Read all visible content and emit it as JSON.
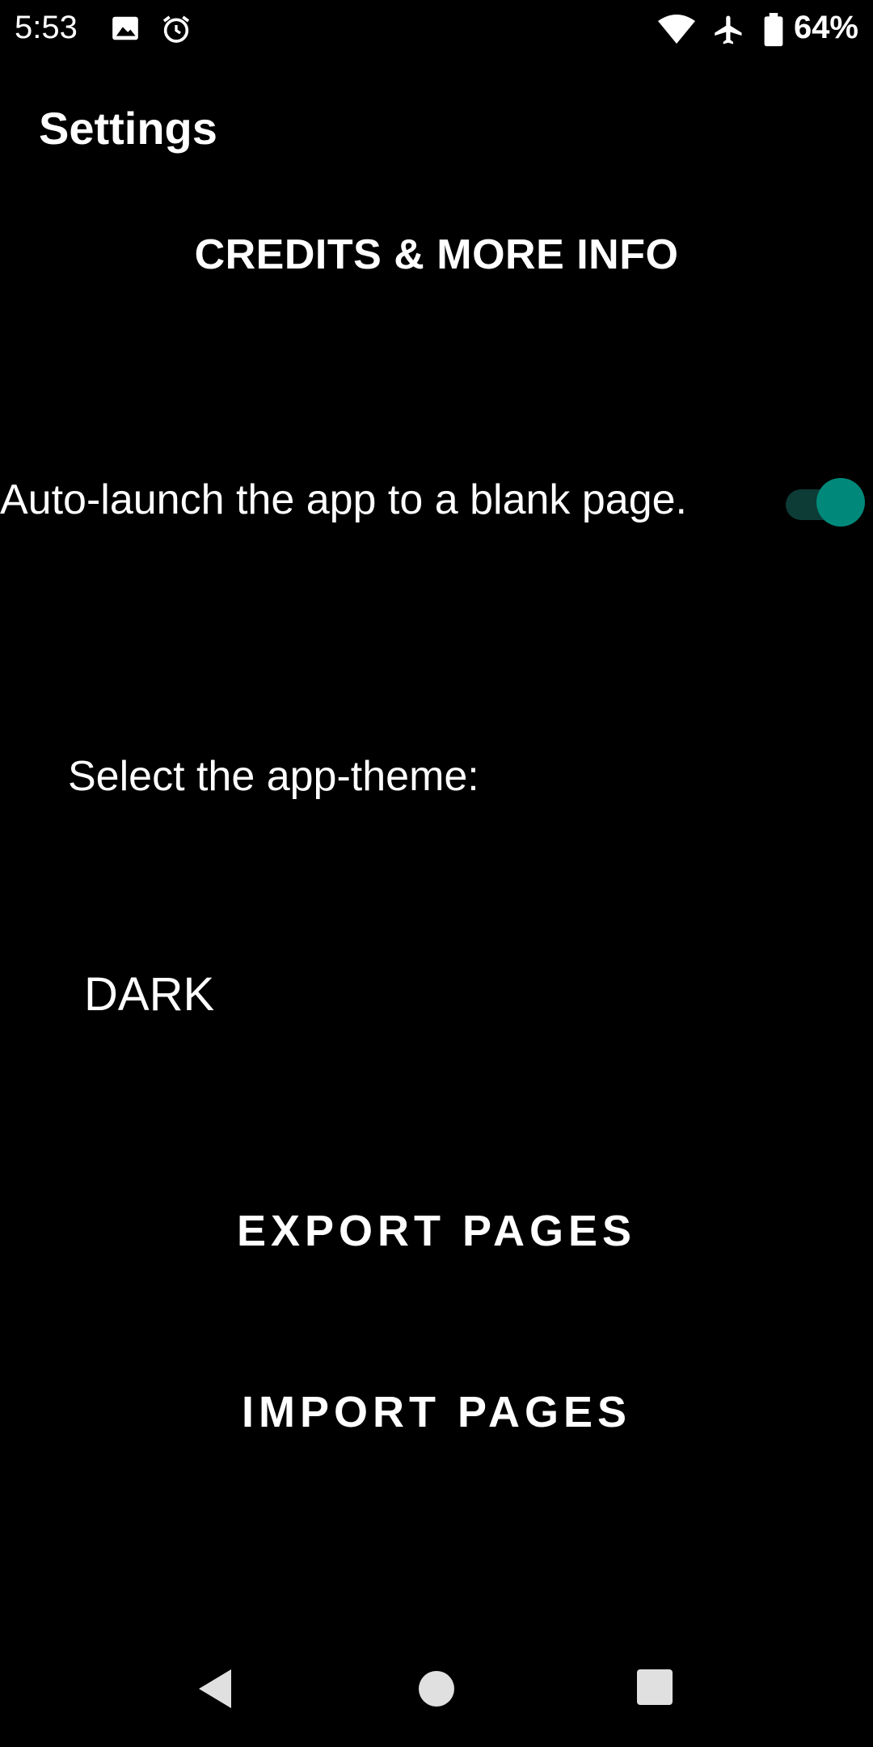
{
  "status_bar": {
    "time": "5:53",
    "battery": "64%",
    "icons": [
      "image-icon",
      "alarm-icon",
      "wifi-icon",
      "airplane-icon",
      "battery-icon"
    ]
  },
  "header": {
    "title": "Settings"
  },
  "credits": {
    "label": "CREDITS & MORE INFO"
  },
  "auto_launch": {
    "label": "Auto-launch the app to a blank page.",
    "enabled": true,
    "accent_color": "#00897b"
  },
  "theme": {
    "label": "Select the app-theme:",
    "selected": "DARK"
  },
  "actions": {
    "export_label": "EXPORT PAGES",
    "import_label": "IMPORT PAGES"
  },
  "nav": {
    "icons": [
      "back-icon",
      "home-icon",
      "recents-icon"
    ]
  }
}
